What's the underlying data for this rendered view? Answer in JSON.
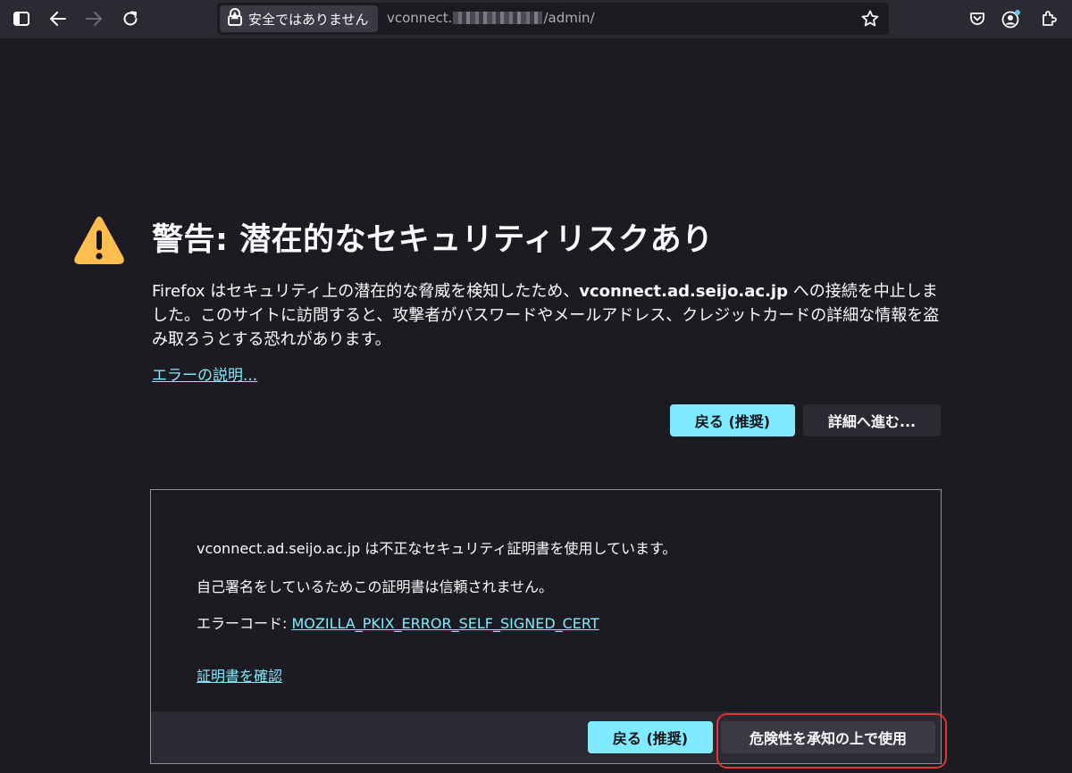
{
  "browser": {
    "url_security_label": "安全ではありません",
    "url_prefix": "vconnect.",
    "url_suffix": "/admin/",
    "icons": {
      "sidebar": "sidebar-icon",
      "back": "back-arrow-icon",
      "forward": "forward-arrow-icon",
      "reload": "reload-icon",
      "lock_warning": "lock-warning-icon",
      "bookmark": "star-icon",
      "pocket": "pocket-icon",
      "account": "account-icon",
      "extensions": "extensions-icon"
    }
  },
  "warning": {
    "title": "警告: 潜在的なセキュリティリスクあり",
    "desc_part1": "Firefox はセキュリティ上の潜在的な脅威を検知したため、",
    "desc_host": "vconnect.ad.seijo.ac.jp",
    "desc_part2": " への接続を中止しました。このサイトに訪問すると、攻撃者がパスワードやメールアドレス、クレジットカードの詳細な情報を盗み取ろうとする恐れがあります。",
    "error_link": "エラーの説明...",
    "go_back_button": "戻る (推奨)",
    "advanced_button": "詳細へ進む..."
  },
  "advanced": {
    "line1": "vconnect.ad.seijo.ac.jp は不正なセキュリティ証明書を使用しています。",
    "line2": "自己署名をしているためこの証明書は信頼されません。",
    "error_code_label": "エラーコード: ",
    "error_code": "MOZILLA_PKIX_ERROR_SELF_SIGNED_CERT",
    "view_cert_link": "証明書を確認",
    "go_back_button": "戻る (推奨)",
    "accept_risk_button": "危険性を承知の上で使用"
  },
  "colors": {
    "accent": "#80ebff",
    "warning_icon": "#ffbd4f",
    "highlight": "#e0342f",
    "background": "#1c1b22"
  }
}
